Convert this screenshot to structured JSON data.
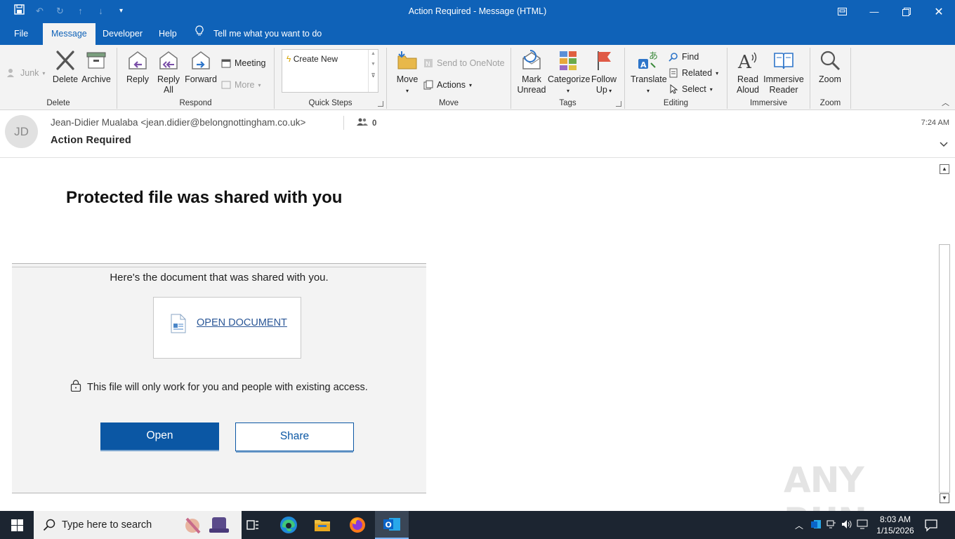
{
  "window": {
    "title": "Action Required  -  Message (HTML)"
  },
  "menu": {
    "tabs": [
      "File",
      "Message",
      "Developer",
      "Help"
    ],
    "tell_me": "Tell me what you want to do"
  },
  "ribbon": {
    "delete_group": {
      "label": "Delete",
      "junk": "Junk",
      "delete": "Delete",
      "archive": "Archive"
    },
    "respond_group": {
      "label": "Respond",
      "reply": "Reply",
      "reply_all_1": "Reply",
      "reply_all_2": "All",
      "forward": "Forward",
      "meeting": "Meeting",
      "more": "More"
    },
    "quick_steps_group": {
      "label": "Quick Steps",
      "create_new": "Create New"
    },
    "move_group": {
      "label": "Move",
      "move": "Move",
      "send_onenote": "Send to OneNote",
      "actions": "Actions"
    },
    "tags_group": {
      "label": "Tags",
      "mark_unread_1": "Mark",
      "mark_unread_2": "Unread",
      "categorize": "Categorize",
      "follow_up_1": "Follow",
      "follow_up_2": "Up"
    },
    "editing_group": {
      "label": "Editing",
      "translate": "Translate",
      "find": "Find",
      "related": "Related",
      "select": "Select"
    },
    "immersive_group": {
      "label": "Immersive",
      "read_aloud_1": "Read",
      "read_aloud_2": "Aloud",
      "immersive_reader_1": "Immersive",
      "immersive_reader_2": "Reader"
    },
    "zoom_group": {
      "label": "Zoom",
      "zoom": "Zoom"
    }
  },
  "message": {
    "avatar_initials": "JD",
    "sender": "Jean-Didier Mualaba <jean.didier@belongnottingham.co.uk>",
    "people_count": "0",
    "subject": "Action Required",
    "time": "7:24 AM"
  },
  "email_body": {
    "headline": "Protected file was shared with you",
    "shared_text": "Here's the document that was shared with you.",
    "open_document": "OPEN DOCUMENT",
    "access_text": "This file will only work for you and people with existing access.",
    "open_button": "Open",
    "share_button": "Share"
  },
  "watermark": "ANY RUN",
  "taskbar": {
    "search_placeholder": "Type here to search",
    "clock_time": "8:03 AM",
    "clock_date": "1/15/2026"
  },
  "colors": {
    "title_bar": "#0f62b8",
    "ribbon_bg": "#f3f3f3",
    "primary_button": "#0b57a4",
    "taskbar": "#1c2531"
  }
}
